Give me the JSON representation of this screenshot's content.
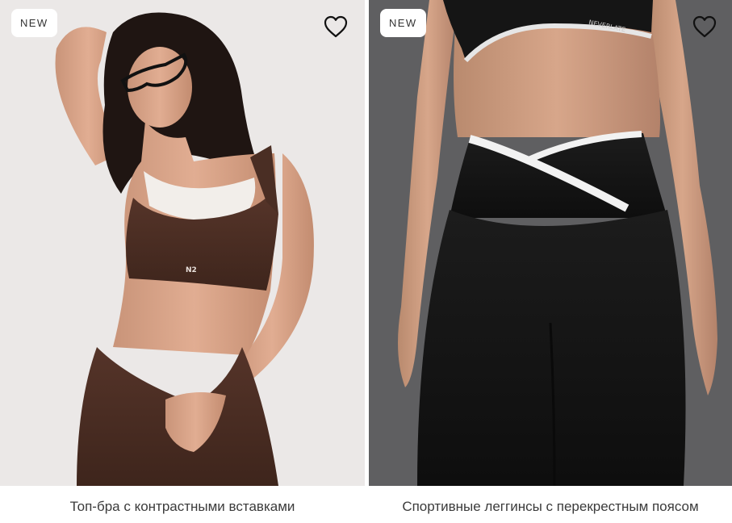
{
  "products": [
    {
      "badge": "NEW",
      "title": "Топ-бра с контрастными вставками",
      "favorite_icon": "heart-outline-icon",
      "colors": {
        "photo_bg": "#ebe8e7",
        "garment": "#4a2e24"
      }
    },
    {
      "badge": "NEW",
      "title": "Спортивные леггинсы с перекрестным поясом",
      "favorite_icon": "heart-outline-icon",
      "colors": {
        "photo_bg": "#5f5f61",
        "garment": "#141414"
      }
    }
  ]
}
